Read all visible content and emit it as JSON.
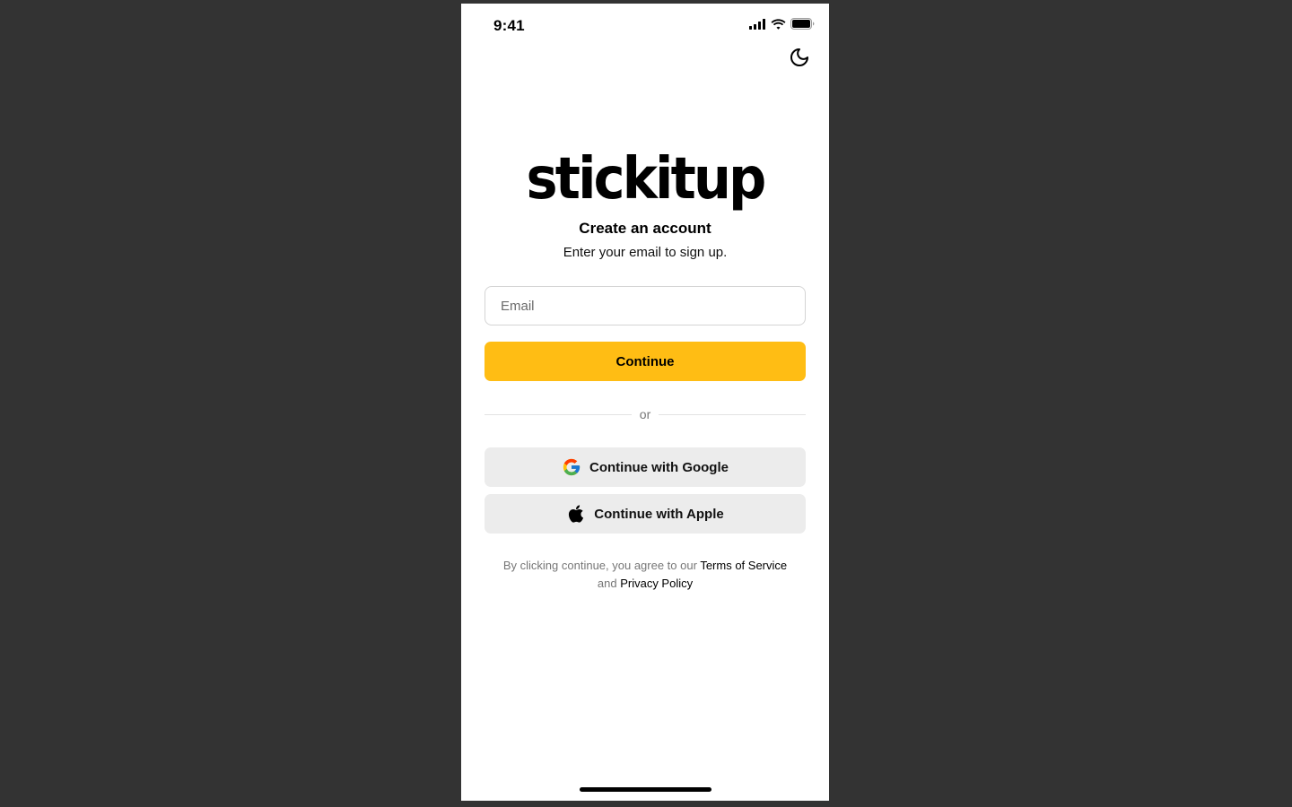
{
  "status_bar": {
    "time": "9:41"
  },
  "icons": {
    "theme_toggle": "moon-icon",
    "google": "google-icon",
    "apple": "apple-icon",
    "signal": "cellular-signal-icon",
    "wifi": "wifi-icon",
    "battery": "battery-icon"
  },
  "brand": {
    "logo_text": "stickitup"
  },
  "header": {
    "title": "Create an account",
    "subtitle": "Enter your email to sign up."
  },
  "form": {
    "email_placeholder": "Email",
    "email_value": "",
    "continue_label": "Continue"
  },
  "divider": {
    "label": "or"
  },
  "social": {
    "google_label": "Continue with Google",
    "apple_label": "Continue with Apple"
  },
  "legal": {
    "prefix": "By clicking continue, you agree to our",
    "terms_link": "Terms of Service",
    "joiner": "and",
    "privacy_link": "Privacy Policy"
  },
  "colors": {
    "accent": "#ffbd14",
    "backdrop": "#333333",
    "social_button_bg": "#ececec"
  }
}
